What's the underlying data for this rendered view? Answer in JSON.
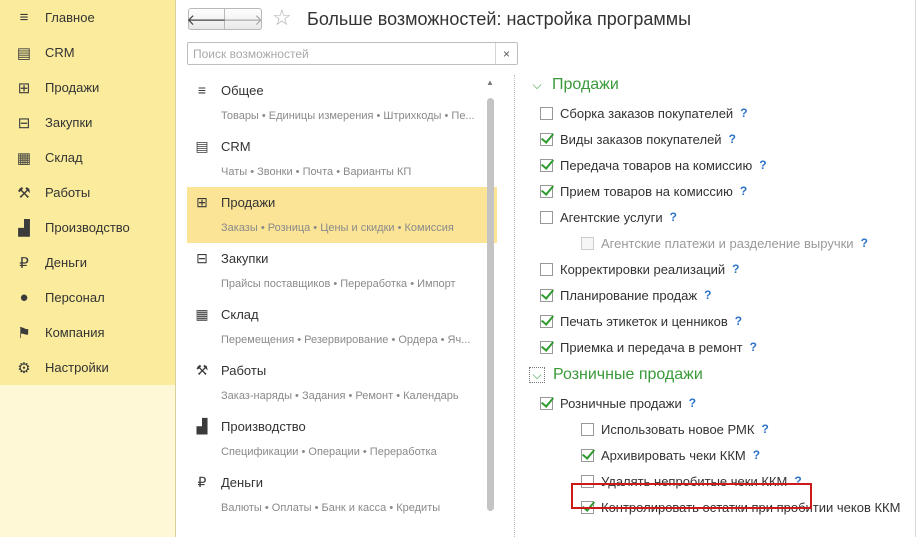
{
  "sidebar": {
    "items": [
      {
        "label": "Главное",
        "icon": "menu-icon"
      },
      {
        "label": "CRM",
        "icon": "contact-card-icon"
      },
      {
        "label": "Продажи",
        "icon": "basket-icon"
      },
      {
        "label": "Закупки",
        "icon": "cart-icon"
      },
      {
        "label": "Склад",
        "icon": "warehouse-grid-icon"
      },
      {
        "label": "Работы",
        "icon": "tools-icon"
      },
      {
        "label": "Производство",
        "icon": "factory-icon"
      },
      {
        "label": "Деньги",
        "icon": "ruble-coin-icon"
      },
      {
        "label": "Персонал",
        "icon": "person-icon"
      },
      {
        "label": "Компания",
        "icon": "flag-icon"
      },
      {
        "label": "Настройки",
        "icon": "gear-icon"
      }
    ]
  },
  "header": {
    "back": "🡐",
    "forward": "🡒",
    "title": "Больше возможностей: настройка программы"
  },
  "search": {
    "placeholder": "Поиск возможностей",
    "value": "",
    "clear": "×"
  },
  "features": [
    {
      "name": "Общее",
      "sub": "Товары • Единицы измерения • Штрихкоды • Пе...",
      "icon": "menu-icon"
    },
    {
      "name": "CRM",
      "sub": "Чаты • Звонки • Почта • Варианты КП",
      "icon": "contact-card-icon"
    },
    {
      "name": "Продажи",
      "sub": "Заказы • Розница • Цены и скидки • Комиссия",
      "icon": "basket-icon",
      "active": true
    },
    {
      "name": "Закупки",
      "sub": "Прайсы поставщиков • Переработка • Импорт",
      "icon": "cart-icon"
    },
    {
      "name": "Склад",
      "sub": "Перемещения • Резервирование • Ордера • Яч...",
      "icon": "warehouse-grid-icon"
    },
    {
      "name": "Работы",
      "sub": "Заказ-наряды • Задания • Ремонт • Календарь",
      "icon": "tools-icon"
    },
    {
      "name": "Производство",
      "sub": "Спецификации • Операции • Переработка",
      "icon": "factory-icon"
    },
    {
      "name": "Деньги",
      "sub": "Валюты • Оплаты • Банк и касса • Кредиты",
      "icon": "ruble-coin-icon"
    }
  ],
  "settings": {
    "sales_title": "Продажи",
    "sales": [
      {
        "label": "Сборка заказов покупателей",
        "checked": false,
        "level": 1,
        "enabled": true
      },
      {
        "label": "Виды заказов покупателей",
        "checked": true,
        "level": 1,
        "enabled": true
      },
      {
        "label": "Передача товаров на комиссию",
        "checked": true,
        "level": 1,
        "enabled": true
      },
      {
        "label": "Прием товаров на комиссию",
        "checked": true,
        "level": 1,
        "enabled": true
      },
      {
        "label": "Агентские услуги",
        "checked": false,
        "level": 1,
        "enabled": true
      },
      {
        "label": "Агентские платежи и разделение выручки",
        "checked": false,
        "level": 2,
        "enabled": false
      },
      {
        "label": "Корректировки реализаций",
        "checked": false,
        "level": 1,
        "enabled": true
      },
      {
        "label": "Планирование продаж",
        "checked": true,
        "level": 1,
        "enabled": true
      },
      {
        "label": "Печать этикеток и ценников",
        "checked": true,
        "level": 1,
        "enabled": true
      },
      {
        "label": "Приемка и передача в ремонт",
        "checked": true,
        "level": 1,
        "enabled": true
      }
    ],
    "retail_title": "Розничные продажи",
    "retail": [
      {
        "label": "Розничные продажи",
        "checked": true,
        "level": 1,
        "enabled": true
      },
      {
        "label": "Использовать новое РМК",
        "checked": false,
        "level": 2,
        "enabled": true
      },
      {
        "label": "Архивировать чеки ККМ",
        "checked": true,
        "level": 2,
        "enabled": true
      },
      {
        "label": "Удалять непробитые чеки ККМ",
        "checked": false,
        "level": 2,
        "enabled": true,
        "highlighted": true
      },
      {
        "label": "Контролировать остатки при пробитии чеков ККМ",
        "checked": true,
        "level": 2,
        "enabled": true,
        "no_help": true
      }
    ],
    "help": "?"
  },
  "colors": {
    "sidebar_bg": "#fbec9d",
    "active_item": "#fbe496",
    "section_title": "#3a9a3a",
    "help": "#2e74c7",
    "highlight_border": "#cc1a1a"
  }
}
